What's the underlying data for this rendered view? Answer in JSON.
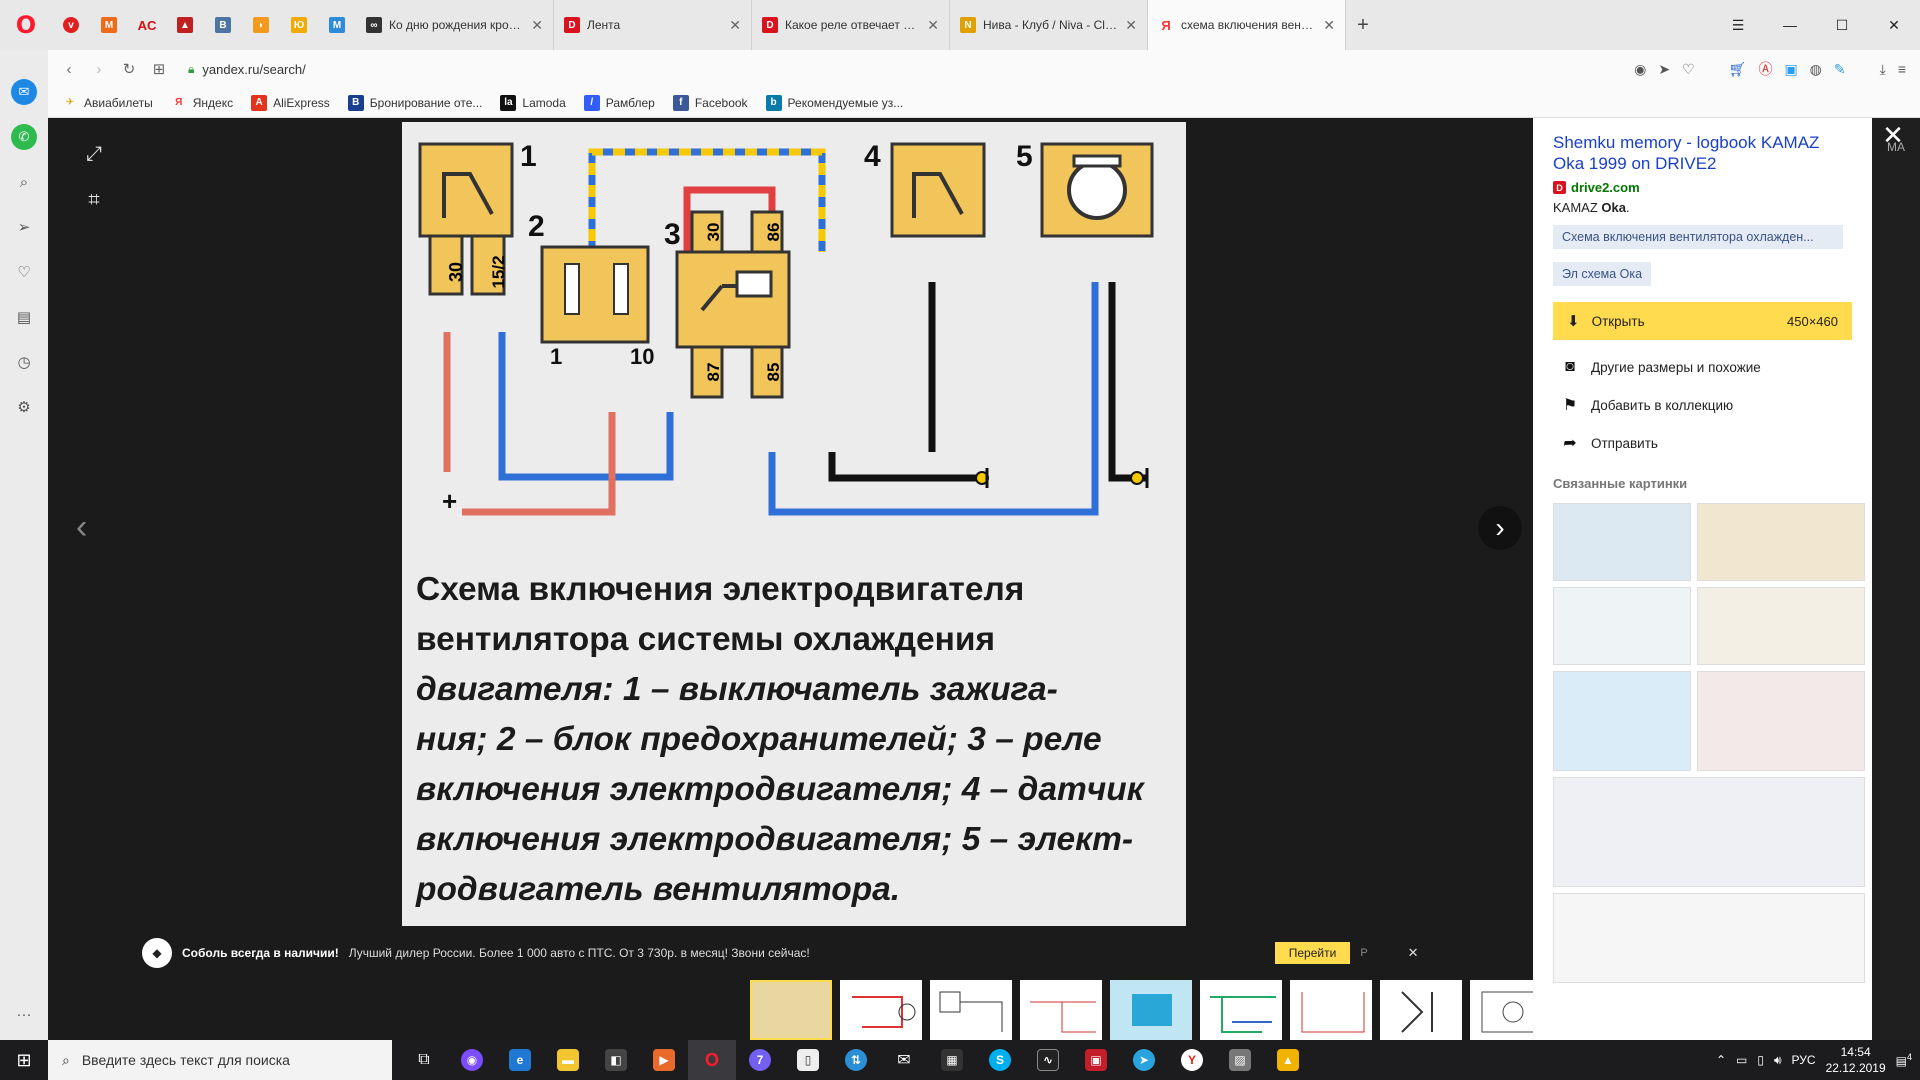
{
  "browser": {
    "pinned": [
      "vivaldi",
      "mx",
      "AC",
      "car",
      "vk",
      "rss",
      "ok",
      "mr"
    ],
    "tabs": [
      {
        "title": "Ко дню рождения кроват",
        "color": "#333333",
        "glyph": "∞",
        "active": false
      },
      {
        "title": "Лента",
        "color": "#d8131f",
        "glyph": "D",
        "active": false
      },
      {
        "title": "Какое реле отвечает за в",
        "color": "#d8131f",
        "glyph": "D",
        "active": false
      },
      {
        "title": "Нива - Клуб / Niva - Club",
        "color": "#e0a000",
        "glyph": "N",
        "active": false
      },
      {
        "title": "схема включения вентил",
        "color": "#ff3333",
        "glyph": "Я",
        "active": true
      }
    ],
    "url": "yandex.ru/search/",
    "bookmarks": [
      {
        "label": "Авиабилеты",
        "glyph": "✈",
        "color": "#e0a000"
      },
      {
        "label": "Яндекс",
        "glyph": "Я",
        "color": "#ff3333"
      },
      {
        "label": "AliExpress",
        "glyph": "A",
        "color": "#e4331c"
      },
      {
        "label": "Бронирование оте...",
        "glyph": "B",
        "color": "#1a3f8f"
      },
      {
        "label": "Lamoda",
        "glyph": "la",
        "color": "#111111"
      },
      {
        "label": "Рамблер",
        "glyph": "/",
        "color": "#315efb"
      },
      {
        "label": "Facebook",
        "glyph": "f",
        "color": "#3b5998"
      },
      {
        "label": "Рекомендуемые уз...",
        "glyph": "b",
        "color": "#0a7aa8"
      }
    ]
  },
  "image": {
    "caption_lines": [
      "Схема включения электродвигателя",
      "вентилятора системы охлаждения",
      "двигателя: 1 – выключатель зажига-",
      "ния; 2 – блок предохранителей; 3 – реле",
      "включения электродвигателя; 4 – датчик",
      "включения электродвигателя; 5 – элект-",
      "родвигатель вентилятора."
    ],
    "labels": {
      "n1": "1",
      "n2": "2",
      "n3": "3",
      "n4": "4",
      "n5": "5",
      "p30": "30",
      "p15": "15/2",
      "r30": "30",
      "r86": "86",
      "r87": "87",
      "r85": "85",
      "f1": "1",
      "f10": "10",
      "plus": "+"
    }
  },
  "ad": {
    "title": "Соболь всегда в наличии!",
    "text": "Лучший дилер России. Более 1 000 авто с ПТС. От 3 730р. в месяц! Звони сейчас!",
    "button": "Перейти",
    "marker": "Р"
  },
  "panel": {
    "title": "Shemku memory - logbook KAMAZ Oka 1999 on DRIVE2",
    "source": "drive2.com",
    "desc_plain": "KAMAZ ",
    "desc_bold": "Oka",
    "desc_end": ".",
    "chip1": "Схема включения вентилятора охлажден...",
    "chip2": "Эл схема Ока",
    "open_label": "Открыть",
    "open_size": "450×460",
    "action_sizes": "Другие размеры и похожие",
    "action_collection": "Добавить в коллекцию",
    "action_send": "Отправить",
    "related_title": "Связанные картинки",
    "thumb_text": "МА"
  },
  "taskbar": {
    "search_placeholder": "Введите здесь текст для поиска",
    "lang": "РУС",
    "time": "14:54",
    "date": "22.12.2019",
    "notifications": "4",
    "viber_badge": "7"
  }
}
